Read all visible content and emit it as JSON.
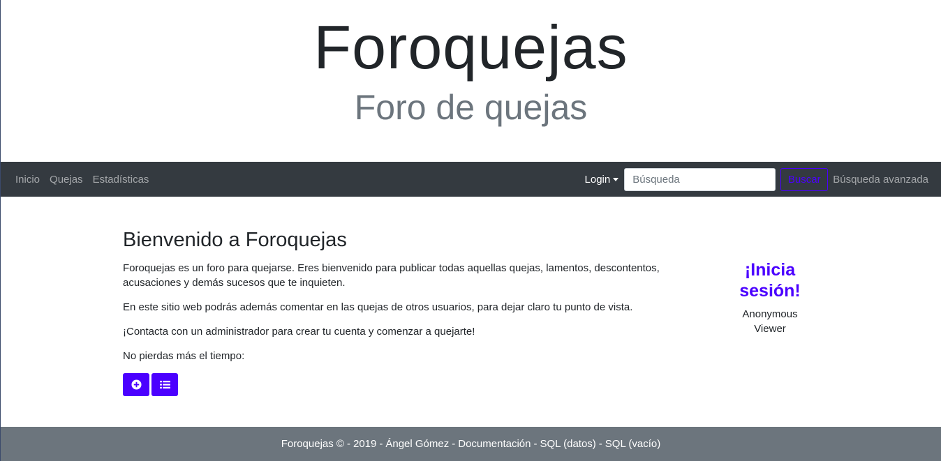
{
  "header": {
    "title": "Foroquejas",
    "subtitle": "Foro de quejas"
  },
  "nav": {
    "links": [
      "Inicio",
      "Quejas",
      "Estadísticas"
    ],
    "login_label": "Login",
    "search_placeholder": "Búsqueda",
    "search_button": "Buscar",
    "advanced_search": "Búsqueda avanzada"
  },
  "main": {
    "title": "Bienvenido a Foroquejas",
    "paragraphs": [
      "Foroquejas es un foro para quejarse. Eres bienvenido para publicar todas aquellas quejas, lamentos, descontentos, acusaciones y demás sucesos que te inquieten.",
      "En este sitio web podrás además comentar en las quejas de otros usuarios, para dejar claro tu punto de vista.",
      "¡Contacta con un administrador para crear tu cuenta y comenzar a quejarte!",
      "No pierdas más el tiempo:"
    ],
    "buttons": [
      {
        "icon": "plus-circle-icon"
      },
      {
        "icon": "list-icon"
      }
    ]
  },
  "sidebar": {
    "cta": "¡Inicia sesión!",
    "user_name": "Anonymous Viewer"
  },
  "footer": {
    "brand": "Foroquejas ©",
    "year": "2019",
    "author": "Ángel Gómez",
    "docs": "Documentación",
    "sql_data": "SQL (datos)",
    "sql_empty": "SQL (vacío)",
    "separator": "-"
  },
  "colors": {
    "accent": "#4b00ff",
    "navbar": "#343a40",
    "footer": "#6c757d"
  }
}
